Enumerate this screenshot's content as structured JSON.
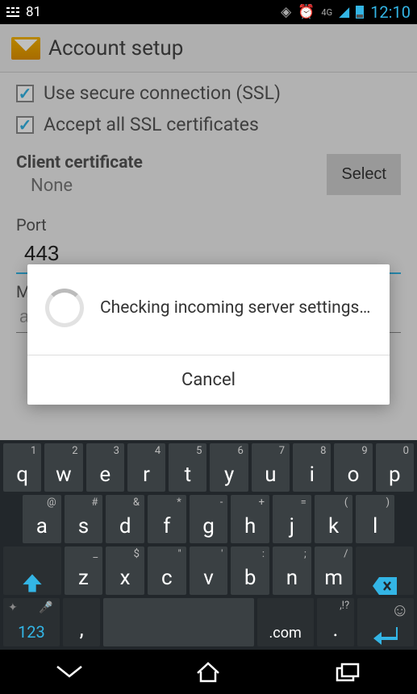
{
  "status": {
    "battery_text": "81",
    "time": "12:10",
    "net_label": "4G"
  },
  "titlebar": {
    "title": "Account setup"
  },
  "checks": {
    "ssl": {
      "label": "Use secure connection (SSL)",
      "checked": true
    },
    "accept_all": {
      "label": "Accept all SSL certificates",
      "checked": true
    }
  },
  "client_cert": {
    "label": "Client certificate",
    "value": "None",
    "button": "Select"
  },
  "port": {
    "label": "Port",
    "value": "443"
  },
  "truncated": {
    "m_label": "M",
    "a_value": "a"
  },
  "dialog": {
    "message": "Checking incoming server settings…",
    "cancel": "Cancel"
  },
  "keyboard": {
    "row1": [
      {
        "main": "q",
        "alt": "1"
      },
      {
        "main": "w",
        "alt": "2"
      },
      {
        "main": "e",
        "alt": "3"
      },
      {
        "main": "r",
        "alt": "4"
      },
      {
        "main": "t",
        "alt": "5"
      },
      {
        "main": "y",
        "alt": "6"
      },
      {
        "main": "u",
        "alt": "7"
      },
      {
        "main": "i",
        "alt": "8"
      },
      {
        "main": "o",
        "alt": "9"
      },
      {
        "main": "p",
        "alt": "0"
      }
    ],
    "row2": [
      {
        "main": "a",
        "alt": "@"
      },
      {
        "main": "s",
        "alt": "#"
      },
      {
        "main": "d",
        "alt": "&"
      },
      {
        "main": "f",
        "alt": "*"
      },
      {
        "main": "g",
        "alt": "-"
      },
      {
        "main": "h",
        "alt": "+"
      },
      {
        "main": "j",
        "alt": "="
      },
      {
        "main": "k",
        "alt": "("
      },
      {
        "main": "l",
        "alt": ")"
      }
    ],
    "row3": [
      {
        "main": "z",
        "alt": "_"
      },
      {
        "main": "x",
        "alt": "$"
      },
      {
        "main": "c",
        "alt": "\""
      },
      {
        "main": "v",
        "alt": "'"
      },
      {
        "main": "b",
        "alt": ":"
      },
      {
        "main": "n",
        "alt": ";"
      },
      {
        "main": "m",
        "alt": "/"
      }
    ],
    "row4": {
      "mode": "123",
      "comma": ",",
      "dotcom": ".com",
      "period": ".",
      "period_alt": ",!?"
    }
  }
}
